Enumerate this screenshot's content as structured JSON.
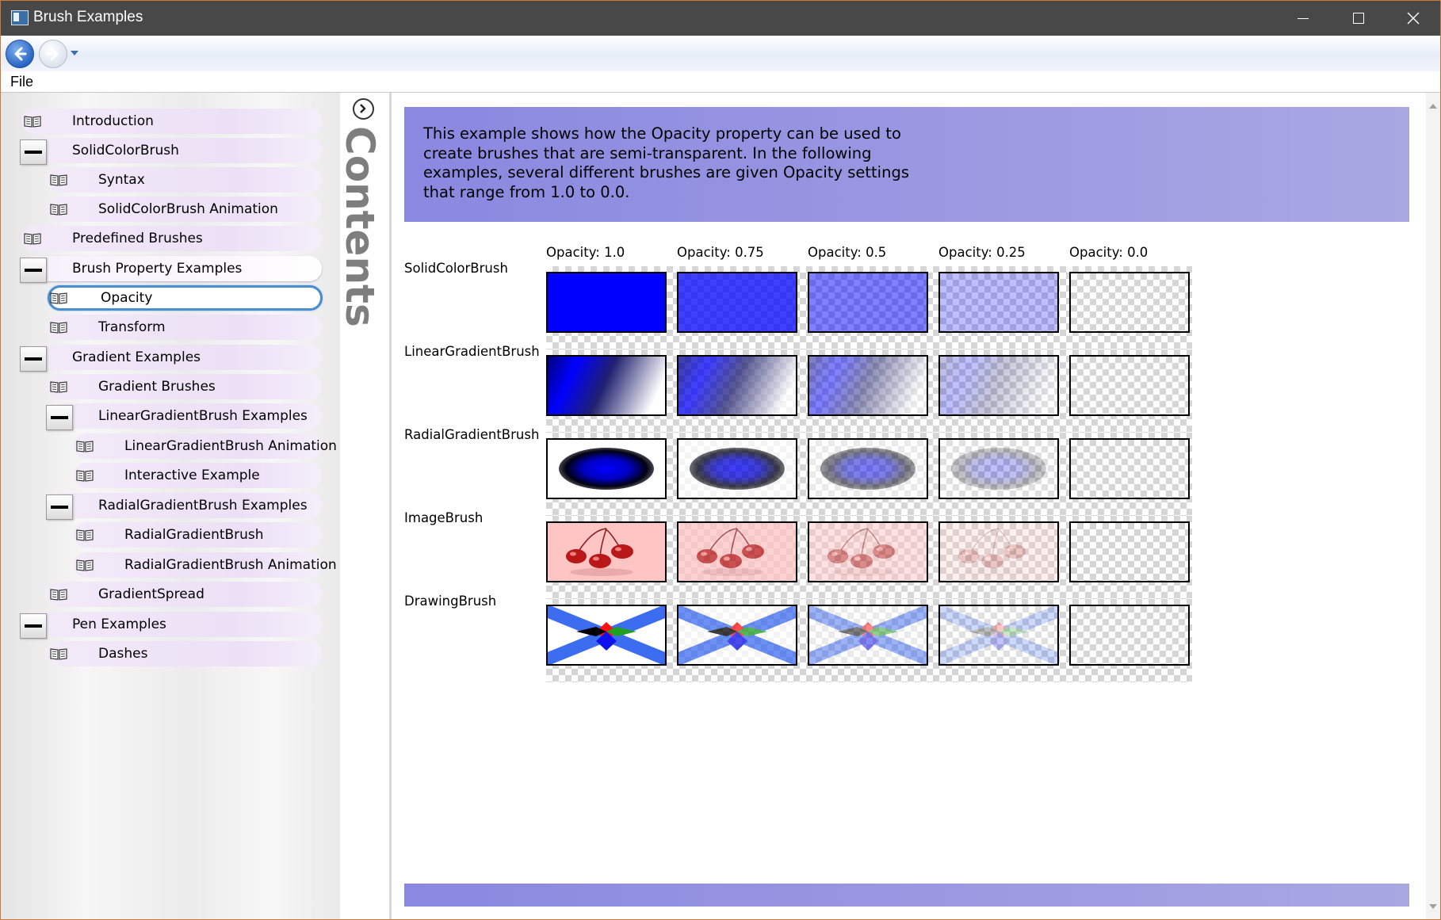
{
  "window": {
    "title": "Brush Examples",
    "controls": [
      "minimize-icon",
      "maximize-icon",
      "close-icon"
    ]
  },
  "nav": {
    "back": "back-arrow-icon",
    "forward": "forward-arrow-icon",
    "history": "history-dropdown-icon"
  },
  "menu": {
    "file": "File"
  },
  "sidebar": {
    "items": [
      {
        "label": "Introduction",
        "icon": "page-icon"
      },
      {
        "label": "SolidColorBrush",
        "icon": "collapse-icon"
      },
      {
        "label": "Syntax",
        "icon": "page-icon"
      },
      {
        "label": "SolidColorBrush Animation",
        "icon": "page-icon"
      },
      {
        "label": "Predefined Brushes",
        "icon": "page-icon"
      },
      {
        "label": "Brush Property Examples",
        "icon": "collapse-icon"
      },
      {
        "label": "Opacity",
        "icon": "page-icon",
        "selected": true
      },
      {
        "label": "Transform",
        "icon": "page-icon"
      },
      {
        "label": "Gradient Examples",
        "icon": "collapse-icon"
      },
      {
        "label": "Gradient Brushes",
        "icon": "page-icon"
      },
      {
        "label": "LinearGradientBrush Examples",
        "icon": "collapse-icon"
      },
      {
        "label": "LinearGradientBrush Animation",
        "icon": "page-icon"
      },
      {
        "label": "Interactive Example",
        "icon": "page-icon"
      },
      {
        "label": "RadialGradientBrush Examples",
        "icon": "collapse-icon"
      },
      {
        "label": "RadialGradientBrush",
        "icon": "page-icon"
      },
      {
        "label": "RadialGradientBrush Animation",
        "icon": "page-icon"
      },
      {
        "label": "GradientSpread",
        "icon": "page-icon"
      },
      {
        "label": "Pen Examples",
        "icon": "collapse-icon"
      },
      {
        "label": "Dashes",
        "icon": "page-icon"
      }
    ]
  },
  "contents_panel": {
    "label": "Contents",
    "toggle_icon": "chevron-right-icon"
  },
  "main": {
    "intro": "This example shows how the Opacity property can be used to create brushes that are semi-transparent. In the following examples, several different brushes are given Opacity settings that range from 1.0 to 0.0.",
    "columns": [
      "Opacity: 1.0",
      "Opacity: 0.75",
      "Opacity: 0.5",
      "Opacity: 0.25",
      "Opacity: 0.0"
    ],
    "opacities": [
      1.0,
      0.75,
      0.5,
      0.25,
      0.0
    ],
    "rows": [
      "SolidColorBrush",
      "LinearGradientBrush",
      "RadialGradientBrush",
      "ImageBrush",
      "DrawingBrush"
    ]
  },
  "colors": {
    "accent_band": "#8a88e0",
    "solid_brush": "#0000ff",
    "selection_border": "#4b8ccc",
    "image_brush_bg": "#ffc4c4"
  }
}
